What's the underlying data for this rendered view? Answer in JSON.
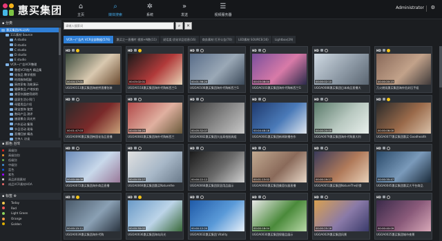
{
  "app": {
    "brand": "惠买集团",
    "user": "Administrator"
  },
  "nav": [
    {
      "label": "主页",
      "icon": "home-icon",
      "glyph": "⌂"
    },
    {
      "label": "媒体搜索",
      "icon": "search-icon",
      "glyph": "⌕"
    },
    {
      "label": "系统",
      "icon": "gear-icon",
      "glyph": "✲"
    },
    {
      "label": "发送",
      "icon": "forward-icon",
      "glyph": "»"
    },
    {
      "label": "视频服务器",
      "icon": "server-icon",
      "glyph": "☰"
    }
  ],
  "sidebar": {
    "category_title": "分类",
    "tree": [
      {
        "label": "惠买集团(ALL)(A)",
        "indent": 0,
        "selected": true
      },
      {
        "label": "111素材 Source",
        "indent": 1
      },
      {
        "label": "A studio",
        "indent": 2
      },
      {
        "label": "B studio",
        "indent": 2
      },
      {
        "label": "C studio",
        "indent": 2
      },
      {
        "label": "D studio",
        "indent": 2
      },
      {
        "label": "E studio",
        "indent": 2
      },
      {
        "label": "VCR一广告VCR整理",
        "indent": 1
      },
      {
        "label": "教程VCR拍片 精品集",
        "indent": 2
      },
      {
        "label": "化妆品 教学视频",
        "indent": 2
      },
      {
        "label": "时尚服饰搭配",
        "indent": 2
      },
      {
        "label": "厨房家电 功能演示",
        "indent": 2
      },
      {
        "label": "健康食品 产地实拍",
        "indent": 2
      },
      {
        "label": "美容仪器使用说明",
        "indent": 2
      },
      {
        "label": "居家生活小窍门",
        "indent": 2
      },
      {
        "label": "母婴用品介绍",
        "indent": 2
      },
      {
        "label": "珠宝首饰 鉴赏",
        "indent": 2
      },
      {
        "label": "数码产品 测评",
        "indent": 2
      },
      {
        "label": "旅游景点 风光片",
        "indent": 2
      },
      {
        "label": "户外运动 集锦",
        "indent": 2
      },
      {
        "label": "节日活动 现场",
        "indent": 2
      },
      {
        "label": "直播回放 精选",
        "indent": 2
      },
      {
        "label": "主持人 访谈",
        "indent": 2
      }
    ],
    "color_title": "颜色 검색",
    "colors": [
      {
        "label": "高级别",
        "hex": "#d22222"
      },
      {
        "label": "高级别别",
        "hex": "#e08a2a"
      },
      {
        "label": "低级别",
        "hex": "#6aa84f"
      },
      {
        "label": "中级别",
        "hex": "#3d85c6"
      },
      {
        "label": "蓝色",
        "hex": "#1155cc"
      },
      {
        "label": "紫色",
        "hex": "#9900ff"
      },
      {
        "label": "高品质图素材",
        "hex": "#cccccc"
      },
      {
        "label": "成品VCR素材HOA",
        "hex": "#e06666"
      }
    ],
    "tag_title": "标签",
    "tags": [
      {
        "label": "Today",
        "hex": "#f2c94c"
      },
      {
        "label": "Red",
        "hex": "#eb5757"
      },
      {
        "label": "Light Green",
        "hex": "#8bd35b"
      },
      {
        "label": "Orange",
        "hex": "#f2994a"
      },
      {
        "label": "Golden",
        "hex": "#e0b000"
      }
    ]
  },
  "search": {
    "placeholder": "请输入搜索词",
    "search_glyph": "⌕",
    "clear_glyph": "✕"
  },
  "tabs": [
    {
      "label": "VCR一广告片 VCR全部数据(576)",
      "active": true
    },
    {
      "label": "惠买之一直播片 视频+N数(11)"
    },
    {
      "label": "说话类 优化学品信息(16)"
    },
    {
      "label": "商务素材 打开公告(70)"
    },
    {
      "label": "LED素材 SOURCE(16)"
    },
    {
      "label": "Lightbox(29)"
    }
  ],
  "cards": [
    {
      "caption": "UGOA0113惠买集团海底捞直播包装",
      "time": "00:04:17:01",
      "dot": "yellow",
      "bg": [
        "#3a4a3c",
        "#d9c9b0",
        "#6b4a2f"
      ]
    },
    {
      "caption": "UGOA0118惠买集团海外代购新西兰G",
      "time": "00:03:02:01",
      "dot": "yellow",
      "bg": [
        "#1a1a1a",
        "#b13a3a",
        "#e6d2b5"
      ]
    },
    {
      "caption": "UGOA0108惠买集团海外代购新西兰G",
      "time": "00:01:36:20",
      "dot": "ring",
      "bg": [
        "#5a6e8a",
        "#9aa8b6",
        "#3c4a5a"
      ]
    },
    {
      "caption": "UGOA0103惠买集团海外代购新西兰G",
      "time": "00:03:08:04",
      "dot": "ring",
      "bg": [
        "#7a4f9c",
        "#d87aa8",
        "#2a2a4a"
      ]
    },
    {
      "caption": "UGOA0088惠买集团日本商品直播大",
      "time": "00:00:02:10",
      "dot": "ring",
      "bg": [
        "#cfd9e2",
        "#8e9aa6",
        "#5b6672"
      ]
    },
    {
      "caption": "万火燃烧惠买集团海外信封压手组",
      "time": "00:00:20:23",
      "dot": "yellow",
      "bg": [
        "#8a6a5a",
        "#c2a28a",
        "#3f3a3a"
      ]
    },
    {
      "caption": "UGOA0090惠买集团韩国化妆品直播",
      "time": "00:01:47:03",
      "dot": "ring",
      "bg": [
        "#2a2a2a",
        "#7a2a2a",
        "#c9a27a"
      ]
    },
    {
      "caption": "UGOA0083惠买集团海外代购新西兰",
      "time": "00:00:56:20",
      "dot": "ring",
      "bg": [
        "#b24a4a",
        "#e0b0a0",
        "#6a5a3a"
      ]
    },
    {
      "caption": "UGOA0082惠买集团大连高档厨具组",
      "time": "00:05:32:07",
      "dot": "ring",
      "bg": [
        "#3a3a3a",
        "#8a8a8a",
        "#c8c8c8"
      ]
    },
    {
      "caption": "UGOA0081惠买集团新闻联播合作",
      "time": "00:04:48:18",
      "dot": "ring",
      "bg": [
        "#1f3a6e",
        "#4a7ab8",
        "#dfe6ee"
      ]
    },
    {
      "caption": "UGOA0079惠买集团海外代购意大利",
      "time": "00:00:20:05",
      "dot": "ring",
      "bg": [
        "#5a7a6a",
        "#b8c8c0",
        "#e8efec"
      ]
    },
    {
      "caption": "UGOA0077惠买集团惠买 Goodhealth",
      "time": "00:00:06:00",
      "dot": "yellow",
      "bg": [
        "#2a2a2a",
        "#9a6a4a",
        "#d8c0a8"
      ]
    },
    {
      "caption": "UGOA0072惠买集团海外商品直播",
      "time": "00:00:46:08",
      "dot": "ring",
      "bg": [
        "#6a8ab8",
        "#c8d8ea",
        "#9a7a9a"
      ]
    },
    {
      "caption": "UGOA0069惠买集团惠买Naturethe",
      "time": "00:00:55:27",
      "dot": "ring",
      "bg": [
        "#e0e0e0",
        "#a8b8c8",
        "#6a7a8a"
      ]
    },
    {
      "caption": "UGOA0068惠买集团家居用品展示",
      "time": "00:00:22:12",
      "dot": "ring",
      "bg": [
        "#1a1a1a",
        "#6a6a6a",
        "#d0d0d0"
      ]
    },
    {
      "caption": "UGOA0060惠买集团美容仪器直播",
      "time": "00:01:13:02",
      "dot": "ring",
      "bg": [
        "#c0a890",
        "#8a6a5a",
        "#e8d8c8"
      ]
    },
    {
      "caption": "UGOA0051惠买集团NatureThe好食",
      "time": "00:00:19:17",
      "dot": "ring",
      "bg": [
        "#3a3a5a",
        "#b07a5a",
        "#e8d0b8"
      ]
    },
    {
      "caption": "UGOA0045惠买集团惠买大平台商品",
      "time": "00:00:35:47",
      "dot": "ring",
      "bg": [
        "#2a4a6a",
        "#7a9aba",
        "#1a2a3a"
      ]
    },
    {
      "caption": "UGOA0039惠买集团海外代购",
      "time": "00:00:15:11",
      "dot": "yellow",
      "bg": [
        "#4a5a6a",
        "#8aa0b4",
        "#2a3440"
      ]
    },
    {
      "caption": "UGOA0036惠买集团海岛风光",
      "time": "00:00:30:02",
      "dot": "yellow",
      "bg": [
        "#6a9ac8",
        "#bcd4e8",
        "#3a6a3a"
      ]
    },
    {
      "caption": "UGOA0032惠买集团 Vitality",
      "time": "00:00:12:20",
      "dot": "ring",
      "bg": [
        "#1f5aa8",
        "#5a9ad8",
        "#e8f0f8"
      ]
    },
    {
      "caption": "UGOA0030惠买集团保健品展示",
      "time": "00:00:18:04",
      "dot": "ring",
      "bg": [
        "#e8e8e8",
        "#4a8a3a",
        "#b8d8a8"
      ]
    },
    {
      "caption": "UGOA0029惠买集团风景",
      "time": "00:00:25:16",
      "dot": "ring",
      "bg": [
        "#d8a050",
        "#8a7aa8",
        "#3a3a6a"
      ]
    },
    {
      "caption": "UGOA0025惠买集团城市夜景",
      "time": "00:00:40:09",
      "dot": "ring",
      "bg": [
        "#3a2a4a",
        "#8a5a7a",
        "#d8a8b8"
      ]
    }
  ]
}
